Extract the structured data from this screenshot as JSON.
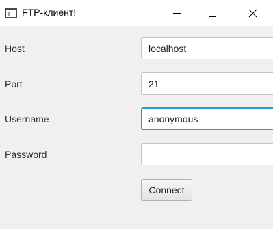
{
  "window": {
    "title": "FTP-клиент!"
  },
  "form": {
    "host": {
      "label": "Host",
      "value": "localhost"
    },
    "port": {
      "label": "Port",
      "value": "21"
    },
    "username": {
      "label": "Username",
      "value": "anonymous"
    },
    "password": {
      "label": "Password",
      "value": ""
    },
    "connect_label": "Connect"
  },
  "colors": {
    "focus_accent": "#2a97dc",
    "background": "#f0f0f0"
  }
}
